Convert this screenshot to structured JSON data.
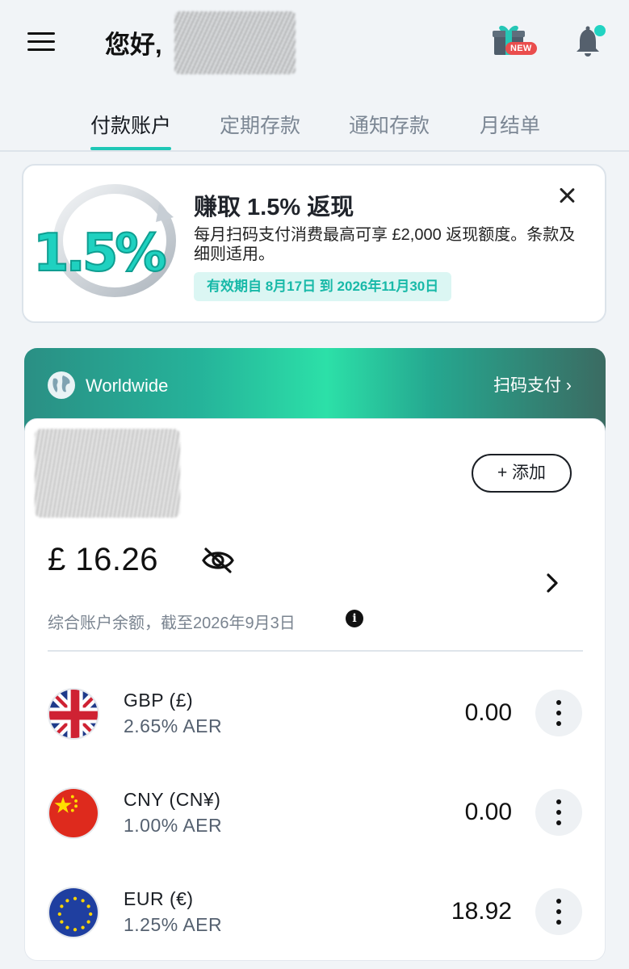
{
  "header": {
    "greeting": "您好,",
    "new_badge": "NEW"
  },
  "tabs": [
    {
      "label": "付款账户",
      "active": true
    },
    {
      "label": "定期存款",
      "active": false
    },
    {
      "label": "通知存款",
      "active": false
    },
    {
      "label": "月结单",
      "active": false
    }
  ],
  "promo": {
    "art_text": "1.5%",
    "title": "赚取 1.5% 返现",
    "description": "每月扫码支付消费最高可享 £2,000 返现额度。条款及细则适用。",
    "validity": "有效期自 8月17日 到 2026年11月30日"
  },
  "account": {
    "band_label": "Worldwide",
    "band_link": "扫码支付 ›",
    "add_button": "+ 添加",
    "balance": "£ 16.26",
    "balance_note": "综合账户余额，截至2026年9月3日",
    "info_glyph": "i",
    "currencies": [
      {
        "name": "GBP (£)",
        "rate": "2.65% AER",
        "amount": "0.00",
        "flag": "uk-flag-icon"
      },
      {
        "name": "CNY (CN¥)",
        "rate": "1.00% AER",
        "amount": "0.00",
        "flag": "china-flag-icon"
      },
      {
        "name": "EUR (€)",
        "rate": "1.25% AER",
        "amount": "18.92",
        "flag": "eu-flag-icon"
      }
    ]
  },
  "colors": {
    "accent": "#1fc7b6",
    "badge_red": "#ea4d4d",
    "validity_bg": "#dbf6f3"
  }
}
